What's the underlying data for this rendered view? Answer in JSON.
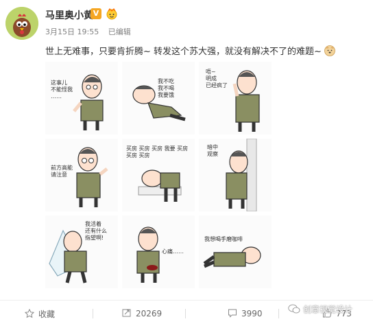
{
  "post": {
    "author": "马里奥小黄",
    "verified_badge": "V",
    "time": "3月15日 19:55",
    "edited": "已编辑",
    "text": "世上无难事，只要肯折腾~ 转发这个苏大强，就没有解决不了的难题~"
  },
  "stickers": [
    {
      "caption": "这事儿\n不能怪我\n……"
    },
    {
      "caption": "我不吃\n我不喝\n我要饿"
    },
    {
      "caption": "唔~\n明成\n已经疯了"
    },
    {
      "caption": "前方高能\n请注意"
    },
    {
      "caption": "买房 买房 买房 我要\n买房 买房 买房"
    },
    {
      "caption": "暗中\n观察"
    },
    {
      "caption": "我活着\n还有什么\n指望啊!"
    },
    {
      "caption": "心痛……"
    },
    {
      "caption": "我想喝手磨咖啡"
    }
  ],
  "actions": {
    "favorite": "收藏",
    "repost": "20269",
    "comment": "3990",
    "like": "773"
  },
  "watermark": "创意视觉设计",
  "colors": {
    "badge": "#f5a623",
    "avatar_bg": "#bcd36a",
    "text_meta": "#808080"
  }
}
